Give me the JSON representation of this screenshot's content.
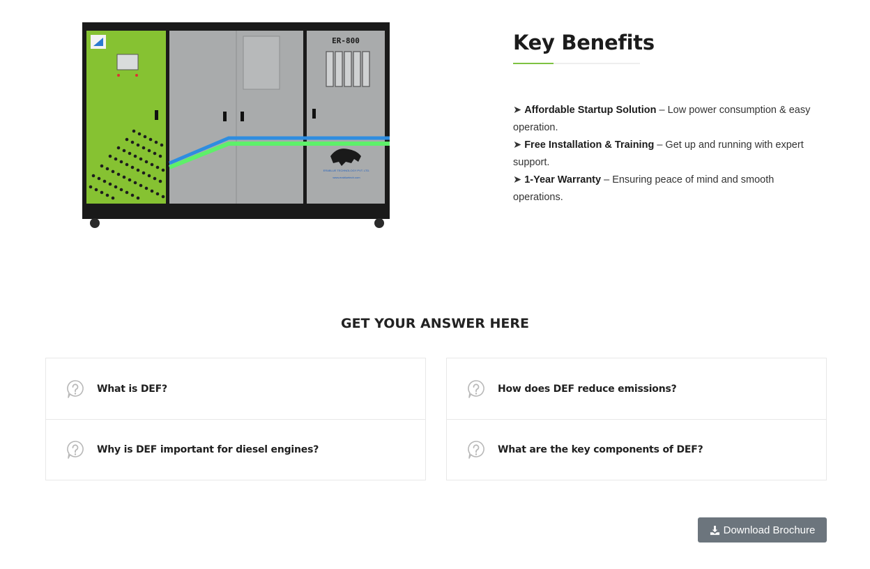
{
  "product": {
    "panel_model": "ER-800",
    "brand_logo_text": "EraBlue",
    "company_plate": "ERABLUE TECHNOLOGY PVT. LTD.",
    "website_plate": "www.erabluetech.com",
    "colors": {
      "green_panel": "#86c232",
      "grey_panel": "#a9abac",
      "frame": "#1a1a1a",
      "stripe_blue": "#2e8de0",
      "stripe_green": "#5ef06a"
    }
  },
  "benefits": {
    "title": "Key Benefits",
    "accent_color": "#7ec242",
    "items": [
      {
        "bullet": "➤",
        "bold": "Affordable Startup Solution",
        "text": " – Low power consumption & easy operation."
      },
      {
        "bullet": "➤",
        "bold": "Free Installation & Training",
        "text": " – Get up and running with expert support."
      },
      {
        "bullet": "➤",
        "bold": "1-Year Warranty",
        "text": " – Ensuring peace of mind and smooth operations."
      }
    ]
  },
  "faq": {
    "heading": "GET YOUR ANSWER HERE",
    "icon": "question-bubble-icon",
    "left": [
      {
        "question": "What is DEF?"
      },
      {
        "question": "Why is DEF important for diesel engines?"
      }
    ],
    "right": [
      {
        "question": "How does DEF reduce emissions?"
      },
      {
        "question": "What are the key components of DEF?"
      }
    ]
  },
  "download": {
    "label": "Download Brochure",
    "icon": "download-icon",
    "color": "#6c757d"
  }
}
